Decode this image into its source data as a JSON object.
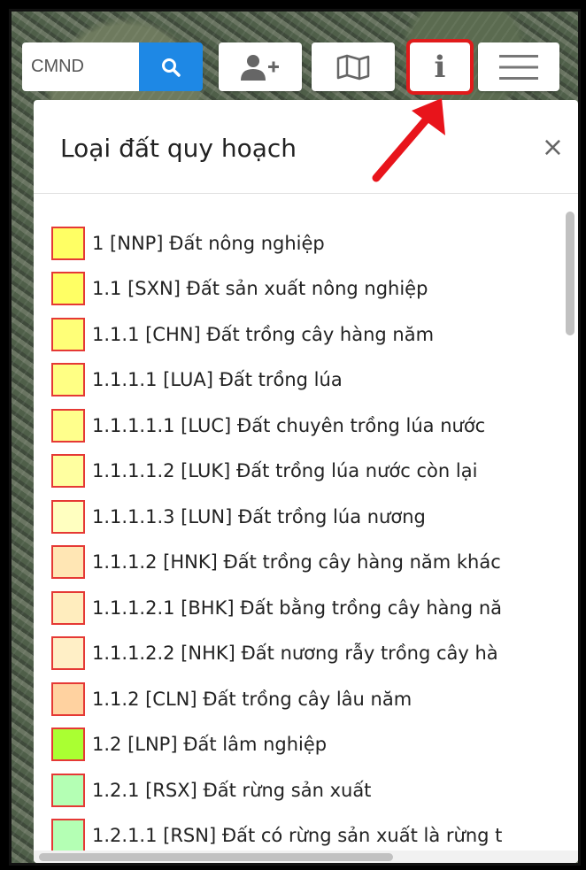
{
  "search": {
    "value": "CMND"
  },
  "toolbar": {
    "buttons": [
      {
        "icon": "search-icon"
      },
      {
        "icon": "add-user-icon"
      },
      {
        "icon": "map-icon"
      },
      {
        "icon": "info-icon"
      },
      {
        "icon": "hamburger-menu-icon"
      }
    ],
    "info_glyph": "i",
    "accent": "#1e88e5",
    "highlight": "#e01b1b"
  },
  "panel": {
    "title": "Loại đất quy hoạch",
    "close": "×"
  },
  "legend": {
    "items": [
      {
        "label": "1 [NNP] Đất nông nghiệp",
        "color": "#ffff64"
      },
      {
        "label": "1.1 [SXN] Đất sản xuất nông nghiệp",
        "color": "#ffff64"
      },
      {
        "label": "1.1.1 [CHN] Đất trồng cây hàng năm",
        "color": "#ffff78"
      },
      {
        "label": "1.1.1.1 [LUA] Đất trồng lúa",
        "color": "#ffff84"
      },
      {
        "label": "1.1.1.1.1 [LUC] Đất chuyên trồng lúa nước",
        "color": "#ffff8c"
      },
      {
        "label": "1.1.1.1.2 [LUK] Đất trồng lúa nước còn lại",
        "color": "#ffffa0"
      },
      {
        "label": "1.1.1.1.3 [LUN] Đất trồng lúa nương",
        "color": "#ffffc0"
      },
      {
        "label": "1.1.1.2 [HNK] Đất trồng cây hàng năm khác",
        "color": "#ffe6b4"
      },
      {
        "label": "1.1.1.2.1 [BHK] Đất bằng trồng cây hàng nă",
        "color": "#ffedbe"
      },
      {
        "label": "1.1.1.2.2 [NHK] Đất nương rẫy trồng cây hà",
        "color": "#ffefc6"
      },
      {
        "label": "1.1.2 [CLN] Đất trồng cây lâu năm",
        "color": "#ffd2a0"
      },
      {
        "label": "1.2 [LNP] Đất lâm nghiệp",
        "color": "#aaff32"
      },
      {
        "label": "1.2.1 [RSX] Đất rừng sản xuất",
        "color": "#b4ffb4"
      },
      {
        "label": "1.2.1.1 [RSN] Đất có rừng sản xuất là rừng t",
        "color": "#b4ffb4"
      }
    ]
  }
}
